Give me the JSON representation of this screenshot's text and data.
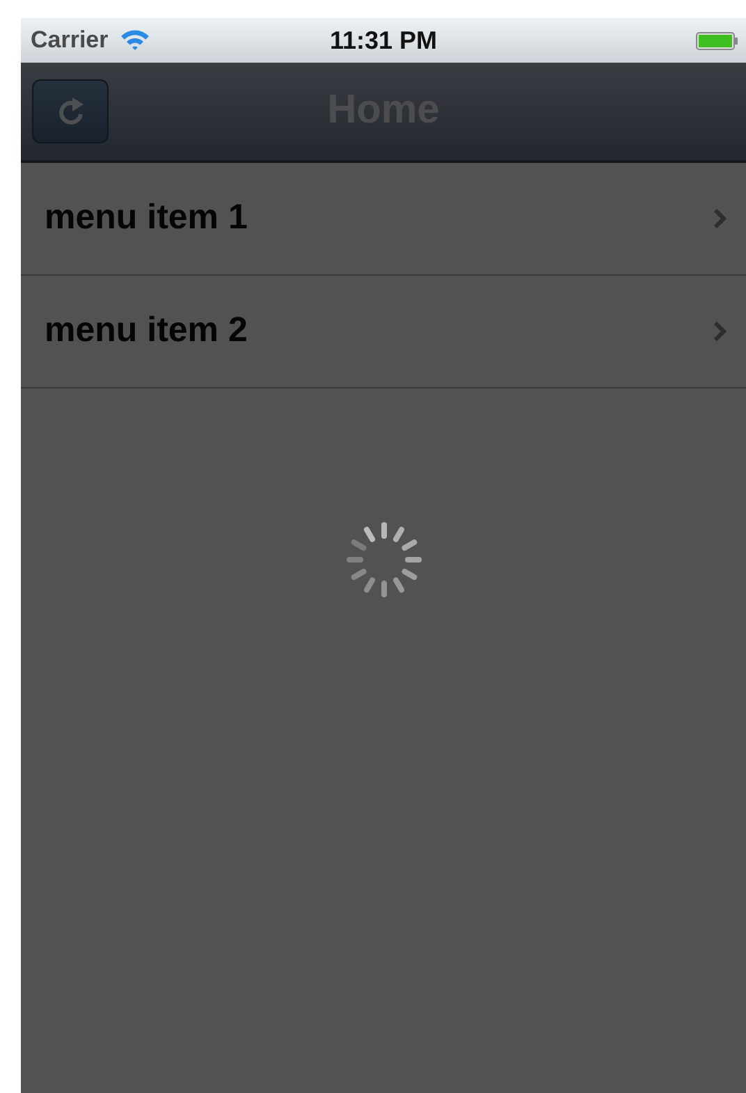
{
  "status_bar": {
    "carrier": "Carrier",
    "time": "11:31 PM"
  },
  "nav_bar": {
    "title": "Home"
  },
  "menu_items": [
    {
      "label": "menu item 1"
    },
    {
      "label": "menu item 2"
    }
  ],
  "loading": true
}
